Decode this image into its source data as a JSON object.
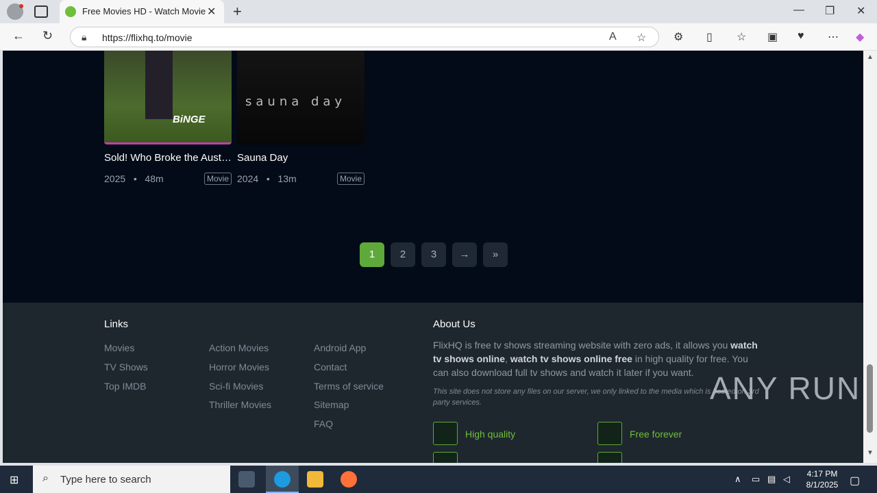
{
  "browser": {
    "tab_title": "Free Movies HD - Watch Movies online",
    "url": "https://flixhq.to/movie",
    "new_tab_symbol": "+",
    "close_symbol": "✕"
  },
  "movies": [
    {
      "title": "Sold! Who Broke the Australian Property Market?",
      "year": "2025",
      "duration": "48m",
      "type": "Movie",
      "poster_text": "BiNGE"
    },
    {
      "title": "Sauna Day",
      "year": "2024",
      "duration": "13m",
      "type": "Movie",
      "poster_text": "sauna day"
    }
  ],
  "meta_separator": "•",
  "pagination": {
    "pages": [
      "1",
      "2",
      "3"
    ],
    "next": "→",
    "last": "»",
    "current": "1"
  },
  "footer": {
    "links_heading": "Links",
    "col1": [
      "Movies",
      "TV Shows",
      "Top IMDB"
    ],
    "col2": [
      "Action Movies",
      "Horror Movies",
      "Sci-fi Movies",
      "Thriller Movies"
    ],
    "col3": [
      "Android App",
      "Contact",
      "Terms of service",
      "Sitemap",
      "FAQ"
    ],
    "about_heading": "About Us",
    "about_pre": "FlixHQ is free tv shows streaming website with zero ads, it allows you ",
    "about_bold1": "watch tv shows online",
    "about_mid": ", ",
    "about_bold2": "watch tv shows online free",
    "about_post": " in high quality for free. You can also download full tv shows and watch it later if you want.",
    "disclaimer": "This site does not store any files on our server, we only linked to the media which is hosted on 3rd party services.",
    "features": [
      "High quality",
      "Free forever"
    ]
  },
  "watermark": "ANY RUN",
  "taskbar": {
    "search_placeholder": "Type here to search",
    "time": "4:17 PM",
    "date": "8/1/2025"
  }
}
